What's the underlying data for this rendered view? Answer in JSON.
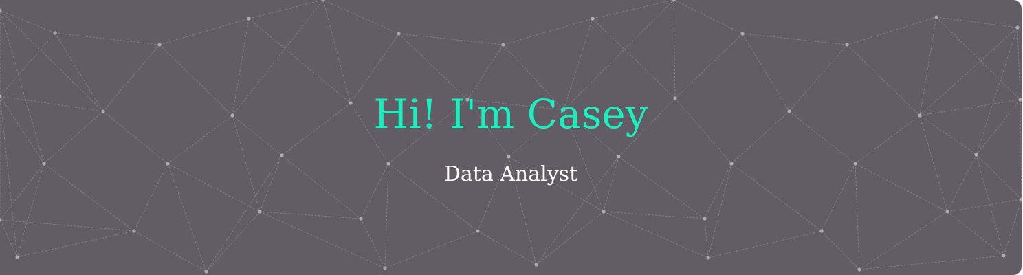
{
  "colors": {
    "background": "#625d65",
    "network_lines": "#8c8890",
    "network_nodes": "#b3b0b6",
    "headline": "#19f0c0",
    "subtitle": "#ffffff"
  },
  "hero": {
    "headline": "Hi! I'm Casey",
    "subtitle": "Data Analyst"
  }
}
